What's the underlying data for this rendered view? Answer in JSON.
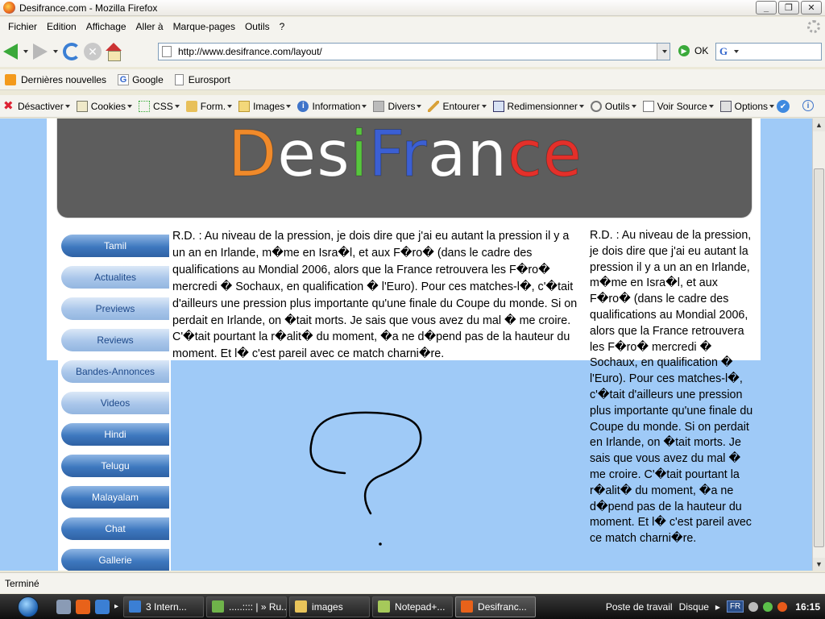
{
  "window": {
    "title": "Desifrance.com - Mozilla Firefox",
    "min": "_",
    "max": "❐",
    "close": "✕"
  },
  "menu": {
    "items": [
      "Fichier",
      "Edition",
      "Affichage",
      "Aller à",
      "Marque-pages",
      "Outils",
      "?"
    ]
  },
  "nav": {
    "url": "http://www.desifrance.com/layout/",
    "go_label": "OK",
    "search_value": ""
  },
  "bookmarks": {
    "items": [
      "Dernières nouvelles",
      "Google",
      "Eurosport"
    ]
  },
  "devtoolbar": {
    "items": [
      "Désactiver",
      "Cookies",
      "CSS",
      "Form.",
      "Images",
      "Information",
      "Divers",
      "Entourer",
      "Redimensionner",
      "Outils",
      "Voir Source",
      "Options"
    ]
  },
  "page": {
    "logo": {
      "letters": [
        "D",
        "e",
        "s",
        "i",
        "F",
        "r",
        "a",
        "n",
        "c",
        "e"
      ],
      "colors": [
        "#f18a2a",
        "#ffffff",
        "#ffffff",
        "#57c63d",
        "#3b5fd3",
        "#3b5fd3",
        "#ffffff",
        "#ffffff",
        "#e4302a",
        "#e4302a"
      ]
    },
    "sidebar": [
      {
        "label": "Tamil",
        "style": "dark"
      },
      {
        "label": "Actualites",
        "style": "light"
      },
      {
        "label": "Previews",
        "style": "light"
      },
      {
        "label": "Reviews",
        "style": "light"
      },
      {
        "label": "Bandes-Annonces",
        "style": "light"
      },
      {
        "label": "Videos",
        "style": "light"
      },
      {
        "label": "Hindi",
        "style": "dark"
      },
      {
        "label": "Telugu",
        "style": "dark"
      },
      {
        "label": "Malayalam",
        "style": "dark"
      },
      {
        "label": "Chat",
        "style": "dark"
      },
      {
        "label": "Gallerie",
        "style": "dark"
      }
    ],
    "main_text": "R.D. : Au niveau de la pression, je dois dire que j'ai eu autant la pression il y a un an en Irlande, m�me en Isra�l, et aux F�ro� (dans le cadre des qualifications au Mondial 2006, alors que la France retrouvera les F�ro� mercredi � Sochaux, en qualification � l'Euro). Pour ces matches-l�, c'�tait d'ailleurs une pression plus importante qu'une finale du Coupe du monde. Si on perdait en Irlande, on �tait morts. Je sais que vous avez du mal � me croire. C'�tait pourtant la r�alit� du moment, �a ne d�pend pas de la hauteur du moment. Et l� c'est pareil avec ce match charni�re.",
    "right_text": "R.D. : Au niveau de la pression, je dois dire que j'ai eu autant la pression il y a un an en Irlande, m�me en Isra�l, et aux F�ro� (dans le cadre des qualifications au Mondial 2006, alors que la France retrouvera les F�ro� mercredi � Sochaux, en qualification � l'Euro). Pour ces matches-l�, c'�tait d'ailleurs une pression plus importante qu'une finale du Coupe du monde. Si on perdait en Irlande, on �tait morts. Je sais que vous avez du mal � me croire. C'�tait pourtant la r�alit� du moment, �a ne d�pend pas de la hauteur du moment. Et l� c'est pareil avec ce match charni�re."
  },
  "status": {
    "text": "Terminé"
  },
  "taskbar": {
    "tasks": [
      {
        "label": "3 Intern...",
        "color": "#3b7fd4"
      },
      {
        "label": ".....:::: | » Ru...",
        "color": "#6fb34a"
      },
      {
        "label": "images",
        "color": "#e9c45a"
      },
      {
        "label": "Notepad+...",
        "color": "#a6c95a"
      },
      {
        "label": "Desifranc...",
        "color": "#e8621a"
      }
    ],
    "tray": {
      "desktop": "Poste de travail",
      "disk": "Disque",
      "lang": "FR",
      "clock": "16:15"
    }
  }
}
